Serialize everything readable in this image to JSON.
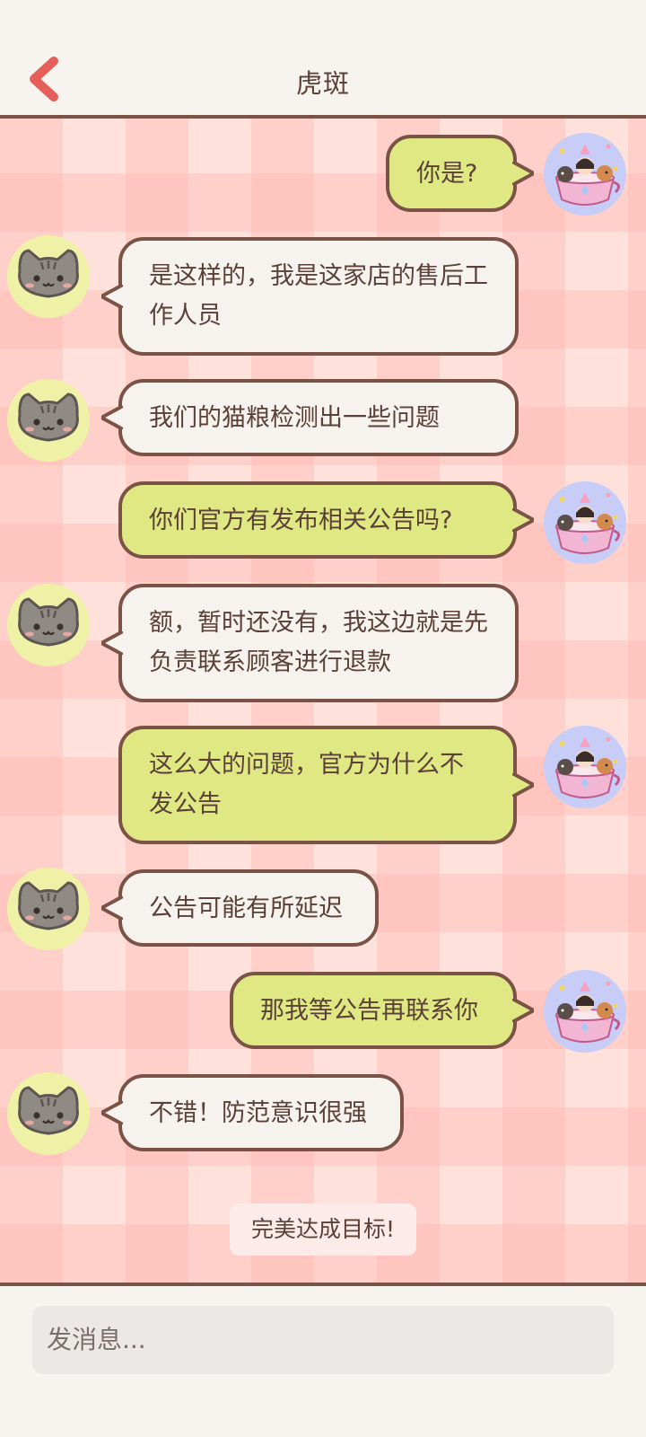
{
  "header": {
    "title": "虎斑",
    "back_icon": "chevron-left-icon"
  },
  "messages": [
    {
      "side": "right",
      "text": "你是?"
    },
    {
      "side": "left",
      "text": "是这样的，我是这家店的售后工作人员"
    },
    {
      "side": "left",
      "text": "我们的猫粮检测出一些问题"
    },
    {
      "side": "right",
      "text": "你们官方有发布相关公告吗?"
    },
    {
      "side": "left",
      "text": "额，暂时还没有，我这边就是先负责联系顾客进行退款"
    },
    {
      "side": "right",
      "text": "这么大的问题，官方为什么不发公告"
    },
    {
      "side": "left",
      "text": "公告可能有所延迟"
    },
    {
      "side": "right",
      "text": "那我等公告再联系你"
    },
    {
      "side": "left",
      "text": "不错！防范意识很强"
    }
  ],
  "status_text": "完美达成目标!",
  "composer": {
    "placeholder": "发消息..."
  },
  "colors": {
    "accent": "#e45f5a",
    "border": "#7a5346",
    "incoming_bubble": "#f6f3ee",
    "outgoing_bubble": "#dfe882"
  }
}
